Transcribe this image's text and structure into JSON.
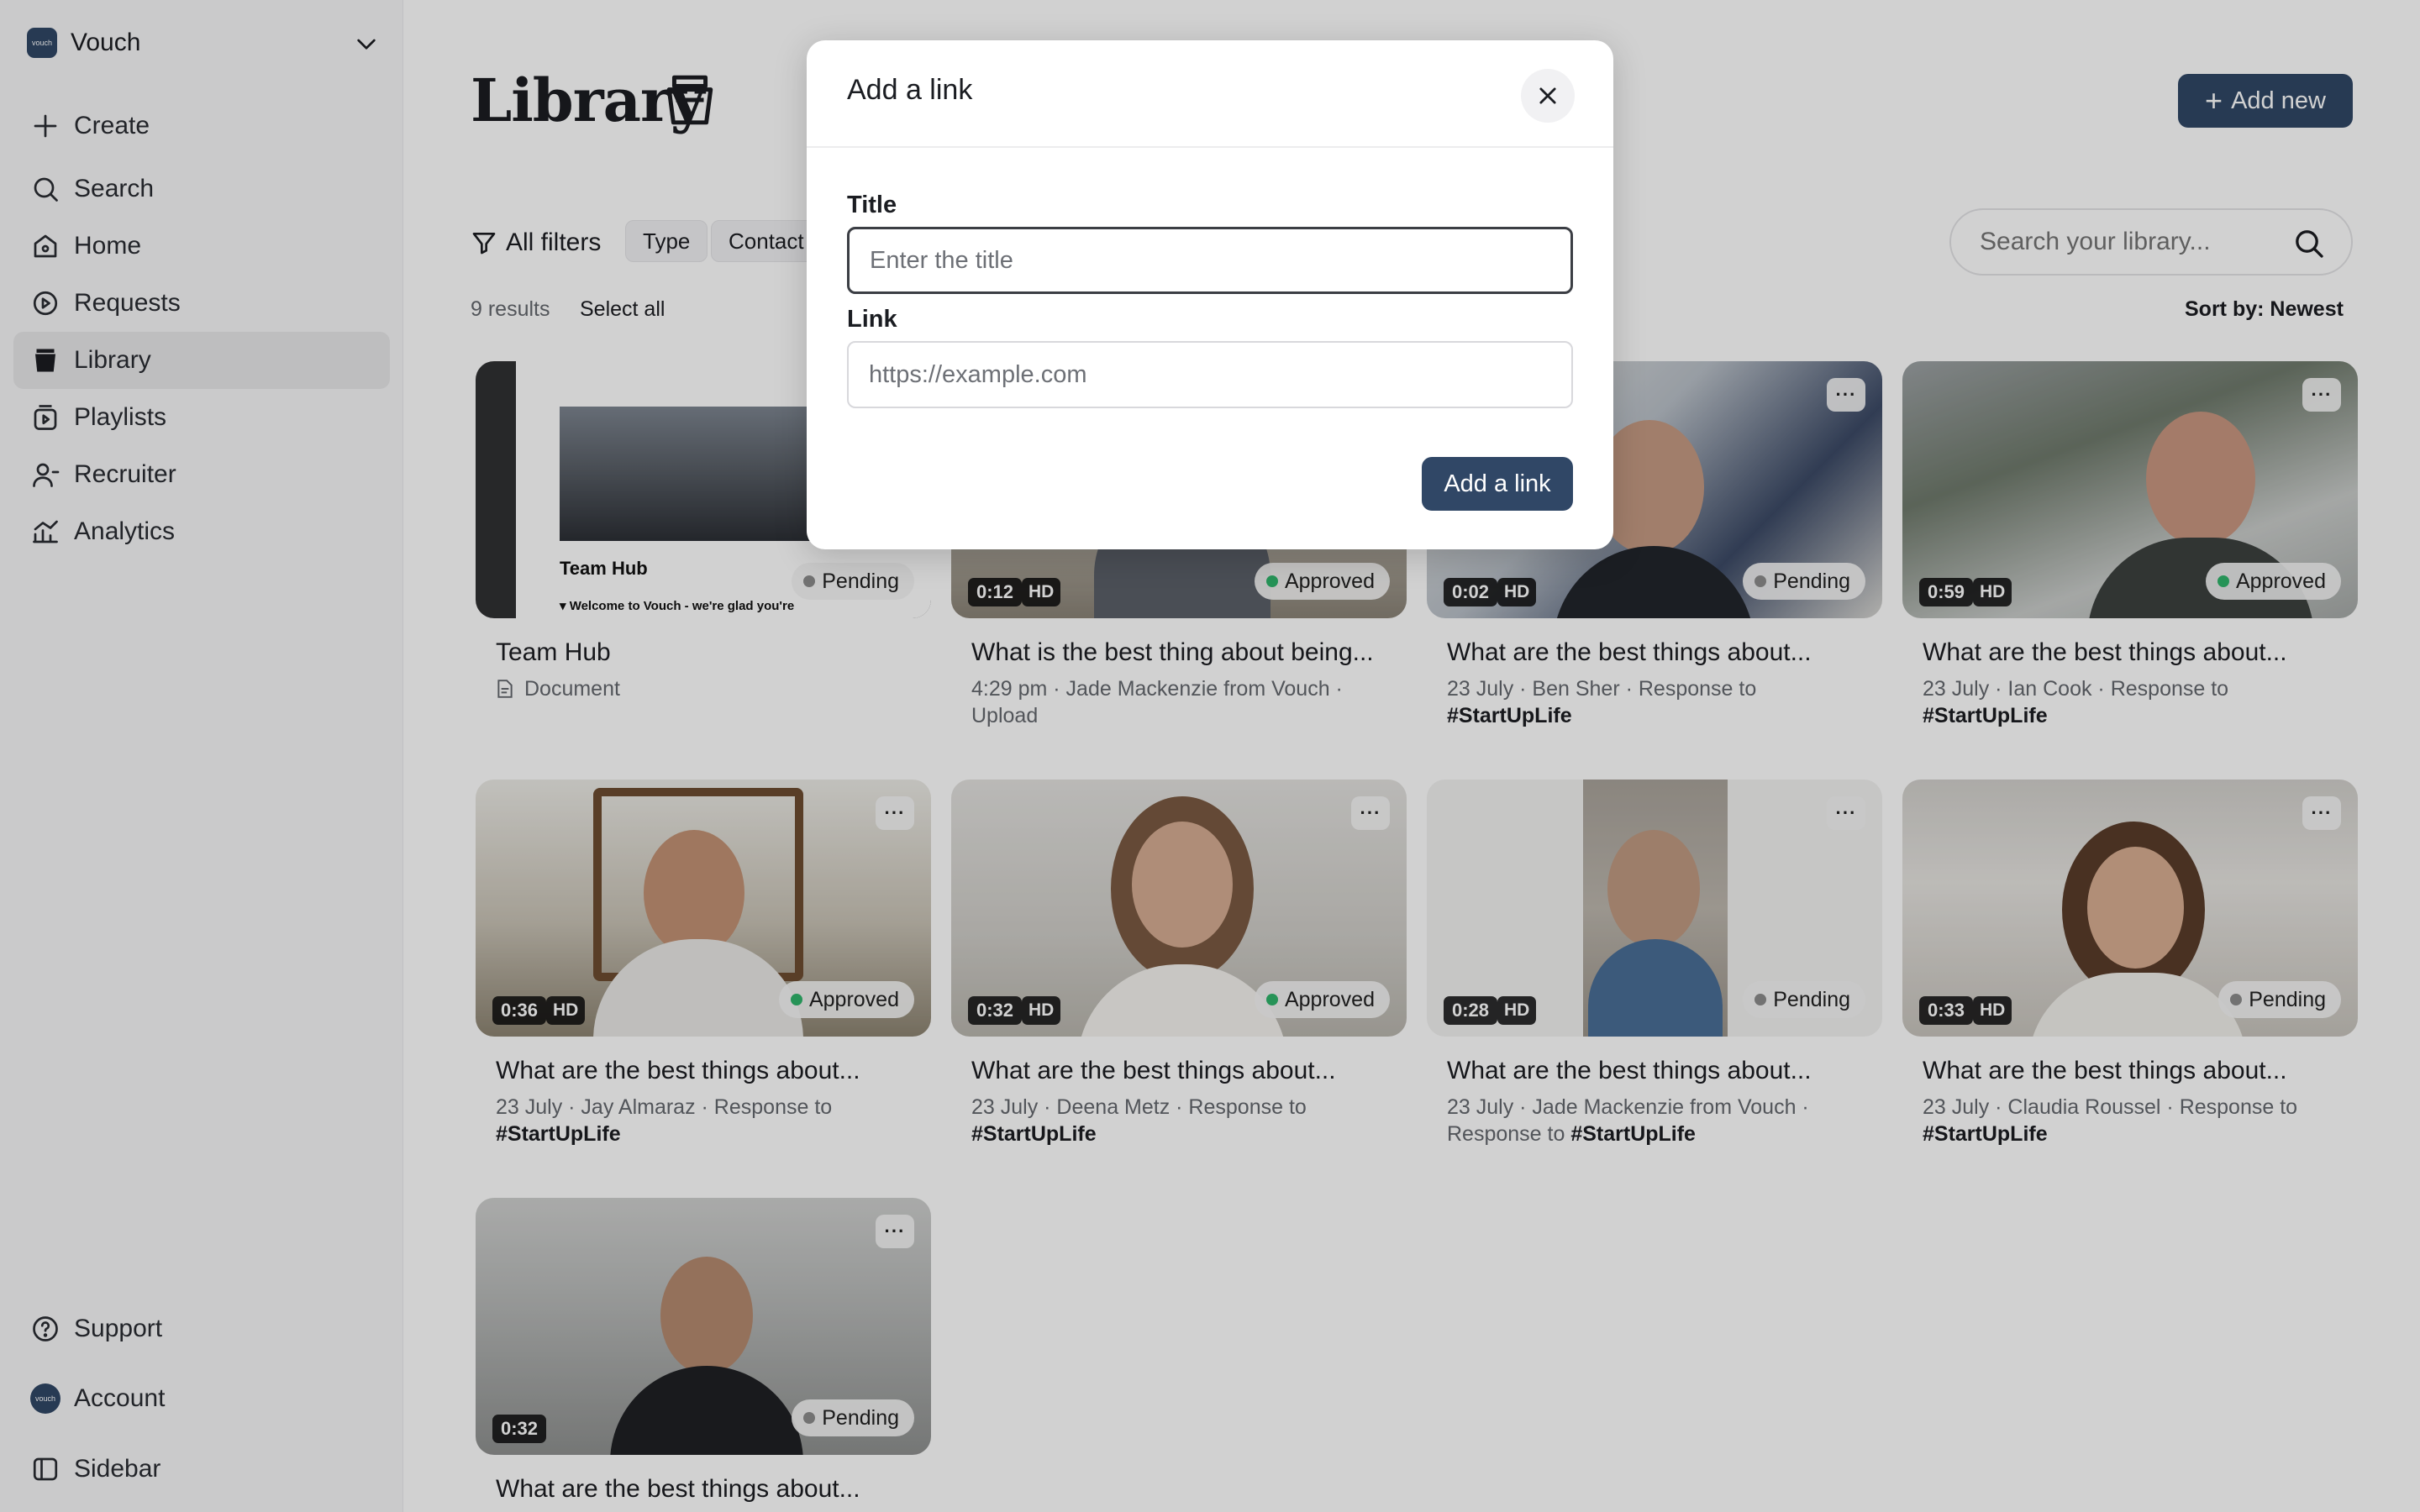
{
  "workspace": {
    "logo_text": "vouch",
    "name": "Vouch"
  },
  "nav": {
    "create": "Create",
    "search": "Search",
    "home": "Home",
    "requests": "Requests",
    "library": "Library",
    "playlists": "Playlists",
    "recruiter": "Recruiter",
    "analytics": "Analytics",
    "support": "Support",
    "account": "Account",
    "sidebar": "Sidebar"
  },
  "header": {
    "title": "Library",
    "add_new": "Add new"
  },
  "filters": {
    "all": "All filters",
    "type": "Type",
    "contact": "Contact"
  },
  "search": {
    "placeholder": "Search your library..."
  },
  "results": {
    "count": "9 results",
    "select_all": "Select all",
    "sort": "Sort by: Newest"
  },
  "colors": {
    "accent": "#304766",
    "approved": "#2fb46b",
    "pending": "#8c8c8c"
  },
  "cards": [
    {
      "title": "Team Hub",
      "type_label": "Document",
      "status": "Pending",
      "thumb_heading": "Team Hub",
      "thumb_caption": "▾ Welcome to Vouch - we're glad you're"
    },
    {
      "title": "What is the best thing about being...",
      "duration": "0:12",
      "hd": "HD",
      "status": "Approved",
      "meta": "4:29 pm · Jade Mackenzie from Vouch · Upload"
    },
    {
      "title": "What are the best things about...",
      "duration": "0:02",
      "hd": "HD",
      "status": "Pending",
      "meta": "23 July · Ben Sher · Response to ",
      "tag": "#StartUpLife"
    },
    {
      "title": "What are the best things about...",
      "duration": "0:59",
      "hd": "HD",
      "status": "Approved",
      "meta": "23 July · Ian Cook · Response to ",
      "tag": "#StartUpLife"
    },
    {
      "title": "What are the best things about...",
      "duration": "0:36",
      "hd": "HD",
      "status": "Approved",
      "meta": "23 July · Jay Almaraz · Response to ",
      "tag": "#StartUpLife"
    },
    {
      "title": "What are the best things about...",
      "duration": "0:32",
      "hd": "HD",
      "status": "Approved",
      "meta": "23 July · Deena Metz · Response to ",
      "tag": "#StartUpLife"
    },
    {
      "title": "What are the best things about...",
      "duration": "0:28",
      "hd": "HD",
      "status": "Pending",
      "meta": "23 July · Jade Mackenzie from Vouch · Response to ",
      "tag": "#StartUpLife"
    },
    {
      "title": "What are the best things about...",
      "duration": "0:33",
      "hd": "HD",
      "status": "Pending",
      "meta": "23 July · Claudia Roussel · Response to ",
      "tag": "#StartUpLife"
    },
    {
      "title": "What are the best things about...",
      "duration": "0:32",
      "status": "Pending"
    }
  ],
  "modal": {
    "title": "Add a link",
    "title_label": "Title",
    "title_placeholder": "Enter the title",
    "link_label": "Link",
    "link_placeholder": "https://example.com",
    "submit": "Add a link"
  }
}
